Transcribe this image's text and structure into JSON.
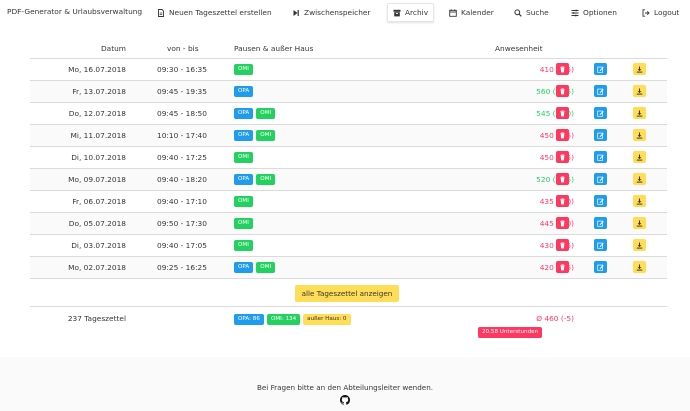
{
  "nav": {
    "brand": "PDF-Generator & Urlaubsverwaltung",
    "items": [
      {
        "label": "Neuen Tageszettel erstellen",
        "icon": "file-icon"
      },
      {
        "label": "Zwischenspeicher",
        "icon": "step-forward-icon"
      },
      {
        "label": "Archiv",
        "icon": "archive-icon",
        "active": true
      },
      {
        "label": "Kalender",
        "icon": "calendar-icon"
      },
      {
        "label": "Suche",
        "icon": "search-icon"
      },
      {
        "label": "Optionen",
        "icon": "sliders-icon"
      },
      {
        "label": "Logout",
        "icon": "logout-icon"
      }
    ]
  },
  "table": {
    "headers": {
      "date": "Datum",
      "time": "von - bis",
      "breaks": "Pausen & außer Haus",
      "presence": "Anwesenheit"
    },
    "rows": [
      {
        "date": "Mo, 16.07.2018",
        "time": "09:30 - 16:35",
        "tags": [
          "OMI"
        ],
        "presence": "410 (-55)",
        "status": "red"
      },
      {
        "date": "Fr, 13.07.2018",
        "time": "09:45 - 19:35",
        "tags": [
          "OPA"
        ],
        "presence": "560 (+95)",
        "status": "green"
      },
      {
        "date": "Do, 12.07.2018",
        "time": "09:45 - 18:50",
        "tags": [
          "OPA",
          "OMI"
        ],
        "presence": "545 (+80)",
        "status": "green"
      },
      {
        "date": "Mi, 11.07.2018",
        "time": "10:10 - 17:40",
        "tags": [
          "OPA",
          "OMI"
        ],
        "presence": "450 (-15)",
        "status": "red"
      },
      {
        "date": "Di, 10.07.2018",
        "time": "09:40 - 17:25",
        "tags": [
          "OMI"
        ],
        "presence": "450 (-15)",
        "status": "red"
      },
      {
        "date": "Mo, 09.07.2018",
        "time": "09:40 - 18:20",
        "tags": [
          "OPA",
          "OMI"
        ],
        "presence": "520 (+55)",
        "status": "green"
      },
      {
        "date": "Fr, 06.07.2018",
        "time": "09:40 - 17:10",
        "tags": [
          "OMI"
        ],
        "presence": "435 (-30)",
        "status": "red"
      },
      {
        "date": "Do, 05.07.2018",
        "time": "09:50 - 17:30",
        "tags": [
          "OMI"
        ],
        "presence": "445 (-20)",
        "status": "red"
      },
      {
        "date": "Di, 03.07.2018",
        "time": "09:40 - 17:05",
        "tags": [
          "OMI"
        ],
        "presence": "430 (-35)",
        "status": "red"
      },
      {
        "date": "Mo, 02.07.2018",
        "time": "09:25 - 16:25",
        "tags": [
          "OPA",
          "OMI"
        ],
        "presence": "420 (-45)",
        "status": "red"
      }
    ],
    "show_all_label": "alle Tageszettel anzeigen"
  },
  "summary": {
    "count": "237 Tageszettel",
    "tags": [
      {
        "label": "OPA: 86",
        "kind": "opa"
      },
      {
        "label": "OMI: 134",
        "kind": "omi"
      },
      {
        "label": "außer Haus: 0",
        "kind": "aus"
      }
    ],
    "average": "Ø 460 (-5)",
    "undertime": "20.58 Unterstunden"
  },
  "footer": {
    "text": "Bei Fragen bitte an den Abteilungsleiter wenden.",
    "icon": "github-icon"
  },
  "colors": {
    "red": "#ff3860",
    "green": "#23d160",
    "blue": "#209cee",
    "yellow": "#ffdd57"
  }
}
